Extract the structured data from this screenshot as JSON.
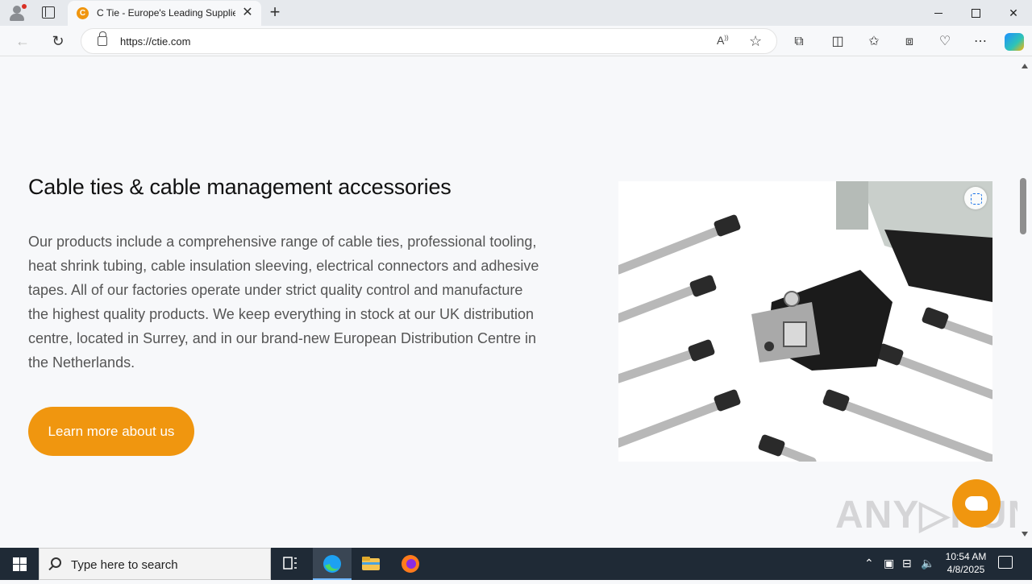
{
  "browser": {
    "tab_title": "C Tie - Europe's Leading Supplier",
    "favicon_letter": "C",
    "url": "https://ctie.com",
    "newtab_glyph": "+",
    "tab_close_glyph": "✕"
  },
  "page": {
    "heading": "Cable ties & cable management accessories",
    "paragraph": "Our products include a comprehensive range of cable ties, professional tooling, heat shrink tubing, cable insulation sleeving, electrical connectors and adhesive tapes. All of our factories operate under strict quality control and manufacture the highest quality products. We keep everything in stock at our UK distribution centre, located in Surrey, and in our brand-new European Distribution Centre in the Netherlands.",
    "cta_label": "Learn more about us",
    "accent_color": "#f0960f",
    "watermark": "ANY▷RUN"
  },
  "taskbar": {
    "search_placeholder": "Type here to search",
    "time": "10:54 AM",
    "date": "4/8/2025"
  }
}
